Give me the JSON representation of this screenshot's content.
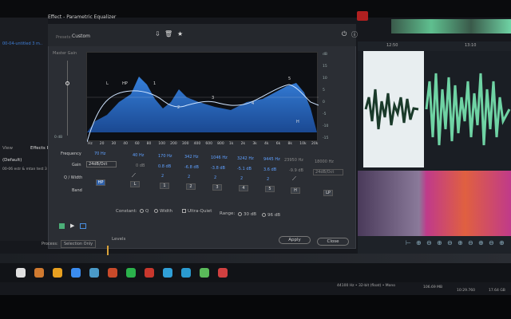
{
  "window": {
    "title": "Effect - Parametric Equalizer"
  },
  "left_panel": {
    "file_label": "00-04-untitled 3 m..",
    "view_tab": "View",
    "effects_tab": "Effects Ra",
    "preset_default": "(Default)",
    "file_row": "00-06 estr & mtan test 3"
  },
  "header": {
    "preset_label": "Presets:",
    "preset_value": "Custom"
  },
  "graph": {
    "master_label": "Master Gain",
    "left_db_ticks": [
      "0 dB"
    ],
    "right_db_ticks": [
      "dB",
      "15",
      "10",
      "5",
      "0",
      "-5",
      "-10",
      "-15"
    ],
    "freq_ticks": [
      "Hz",
      "20",
      "30",
      "40",
      "60",
      "80",
      "100",
      "200",
      "300",
      "400",
      "600",
      "800",
      "1k",
      "2k",
      "3k",
      "4k",
      "6k",
      "8k",
      "10k",
      "20k"
    ],
    "point_labels": [
      "L",
      "HP",
      "1",
      "2",
      "3",
      "4",
      "5",
      "H"
    ],
    "curve_color": "#2f7ee0"
  },
  "controls": {
    "frequency_label": "Frequency",
    "gain_label": "Gain",
    "q_label": "Q / Width",
    "band_label": "Band",
    "hp_freq": "70 Hz",
    "hp_slope": "24dB/Oct",
    "l_freq": "40 Hz",
    "l_gain": "0 dB",
    "bands": [
      {
        "freq": "170 Hz",
        "gain": "0.8 dB",
        "q": "2",
        "btn": "1"
      },
      {
        "freq": "342 Hz",
        "gain": "-6.8 dB",
        "q": "2",
        "btn": "2"
      },
      {
        "freq": "1046 Hz",
        "gain": "-3.8 dB",
        "q": "2",
        "btn": "3"
      },
      {
        "freq": "3242 Hz",
        "gain": "-5.1 dB",
        "q": "2",
        "btn": "4"
      },
      {
        "freq": "9445 Hz",
        "gain": "3.6 dB",
        "q": "2",
        "btn": "5"
      }
    ],
    "h_freq": "23950 Hz",
    "h_gain": "-9.9 dB",
    "lp_freq": "18000 Hz",
    "lp_slope": "24dB/Oct",
    "hp_btn": "HP",
    "l_btn": "L",
    "h_btn": "H",
    "lp_btn": "LP"
  },
  "constant": {
    "label": "Constant:",
    "q": "Q",
    "width": "Width",
    "ultra_quiet": "Ultra-Quiet",
    "range_label": "Range:",
    "r30": "30 dB",
    "r96": "96 dB"
  },
  "buttons": {
    "apply": "Apply",
    "close": "Close"
  },
  "levels_label": "Levels",
  "process": {
    "label": "Process:",
    "value": "Selection Only"
  },
  "timeline": {
    "t1": "12:50",
    "t2": "13:10"
  },
  "status": {
    "format": "44100 Hz • 32-bit (float) • Mono",
    "size": "106.69 MB",
    "duration": "10:29.760",
    "free": "17.64 GB"
  },
  "colors": {
    "accent_blue": "#2f7ee0",
    "wave_green": "#6fd3a4",
    "spectral": "#c03a8a"
  }
}
